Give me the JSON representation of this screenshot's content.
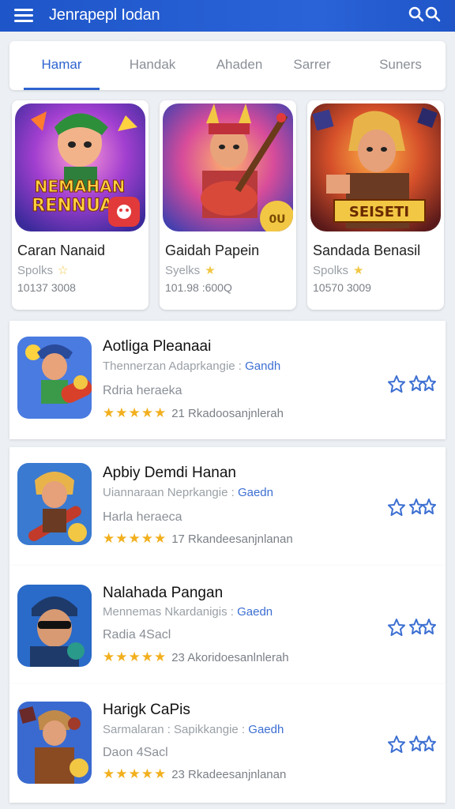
{
  "appbar": {
    "title": "Jenrapepl Iodan",
    "menu_icon": "hamburger-menu-icon",
    "search_icon": "search-icon",
    "color": "#1e56c9"
  },
  "tabs": [
    {
      "label": "Hamar",
      "active": true
    },
    {
      "label": "Handak",
      "active": false
    },
    {
      "label": "Ahaden",
      "active": false
    },
    {
      "label": "Sarrer",
      "active": false
    },
    {
      "label": "Suners",
      "active": false
    }
  ],
  "featured": [
    {
      "name": "Caran Nanaid",
      "category": "Spolks",
      "count": "10137 3008",
      "art_text": "NEMAHAN RENNUAN",
      "badge": "bug-badge-icon"
    },
    {
      "name": "Gaidah Papein",
      "category": "Syelks",
      "count": "101.98 :600Q",
      "art_text": "",
      "badge": "coin-badge-icon"
    },
    {
      "name": "Sandada Benasil",
      "category": "Spolks",
      "count": "10570 3009",
      "art_text": "SEISETI",
      "badge": ""
    }
  ],
  "list": [
    {
      "name": "Aotliga Pleanaai",
      "subtitle": "Thennerzan Adaprkangie :",
      "link": "Gandh",
      "desc": "Rdria heraeka",
      "stars": "★★★★★",
      "rating_text": "21 Rkadoosanjnlerah"
    },
    {
      "name": "Apbiy Demdi Hanan",
      "subtitle": "Uiannaraan Neprkangie :",
      "link": "Gaedn",
      "desc": "Harla heraeca",
      "stars": "★★★★★",
      "rating_text": "17 Rkandeesanjnlanan"
    },
    {
      "name": "Nalahada Pangan",
      "subtitle": "Mennemas Nkardanigis :",
      "link": "Gaedn",
      "desc": "Radia 4Sacl",
      "stars": "★★★★★",
      "rating_text": "23 Akoridoesanlnlerah"
    },
    {
      "name": "Harigk CaPis",
      "subtitle": "Sarmalaran : Sapikkangie :",
      "link": "Gaedh",
      "desc": "Daon 4Sacl",
      "stars": "★★★★★",
      "rating_text": "23 Rkadeesanjnlanan"
    }
  ],
  "colors": {
    "accent": "#2e63cf",
    "star": "#f2b01e"
  }
}
